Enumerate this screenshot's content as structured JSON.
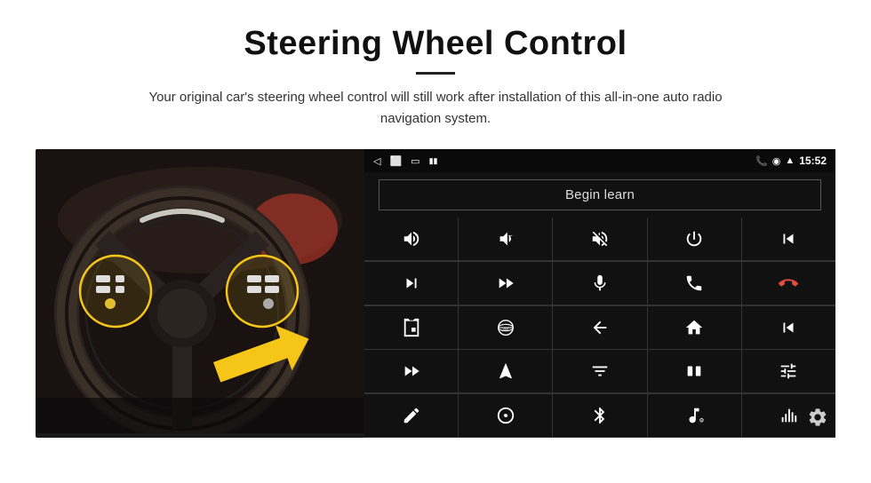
{
  "header": {
    "title": "Steering Wheel Control",
    "subtitle": "Your original car's steering wheel control will still work after installation of this all-in-one auto radio navigation system."
  },
  "status_bar": {
    "time": "15:52",
    "back_icon": "◁",
    "home_icon": "□",
    "recent_icon": "▭",
    "signal_icon": "▦",
    "phone_icon": "📞",
    "location_icon": "⊛",
    "wifi_icon": "⬡"
  },
  "begin_learn": {
    "label": "Begin learn"
  },
  "controls": [
    {
      "id": "vol-up",
      "icon": "vol_up"
    },
    {
      "id": "vol-down",
      "icon": "vol_down"
    },
    {
      "id": "mute",
      "icon": "mute"
    },
    {
      "id": "power",
      "icon": "power"
    },
    {
      "id": "prev-track",
      "icon": "prev_track"
    },
    {
      "id": "next-track",
      "icon": "next"
    },
    {
      "id": "ff",
      "icon": "ff"
    },
    {
      "id": "mic",
      "icon": "mic"
    },
    {
      "id": "phone",
      "icon": "phone"
    },
    {
      "id": "end-call",
      "icon": "end_call"
    },
    {
      "id": "camera",
      "icon": "camera"
    },
    {
      "id": "360",
      "icon": "360"
    },
    {
      "id": "back",
      "icon": "back_arrow"
    },
    {
      "id": "home",
      "icon": "home"
    },
    {
      "id": "prev-chapter",
      "icon": "prev_chapter"
    },
    {
      "id": "fast-fwd",
      "icon": "fast_fwd2"
    },
    {
      "id": "nav",
      "icon": "navigate"
    },
    {
      "id": "eq",
      "icon": "equalizer"
    },
    {
      "id": "record",
      "icon": "record"
    },
    {
      "id": "settings-sliders",
      "icon": "sliders"
    },
    {
      "id": "edit",
      "icon": "edit"
    },
    {
      "id": "compass",
      "icon": "compass"
    },
    {
      "id": "bluetooth",
      "icon": "bluetooth"
    },
    {
      "id": "music",
      "icon": "music"
    },
    {
      "id": "chart",
      "icon": "chart"
    }
  ],
  "settings_icon": "⚙"
}
